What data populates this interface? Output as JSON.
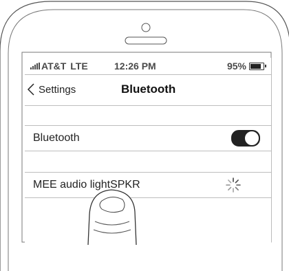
{
  "status_bar": {
    "carrier": "AT&T",
    "network": "LTE",
    "time": "12:26 PM",
    "battery": "95%",
    "battery_level": 0.95
  },
  "nav": {
    "back_label": "Settings",
    "title": "Bluetooth"
  },
  "bluetooth_row": {
    "label": "Bluetooth",
    "toggle_on": true
  },
  "devices": [
    {
      "name": "MEE audio lightSPKR",
      "status": "connecting"
    }
  ],
  "icons": {
    "signal": "signal-bars-icon",
    "battery": "battery-icon",
    "back": "chevron-left-icon",
    "spinner": "loading-spinner-icon"
  }
}
